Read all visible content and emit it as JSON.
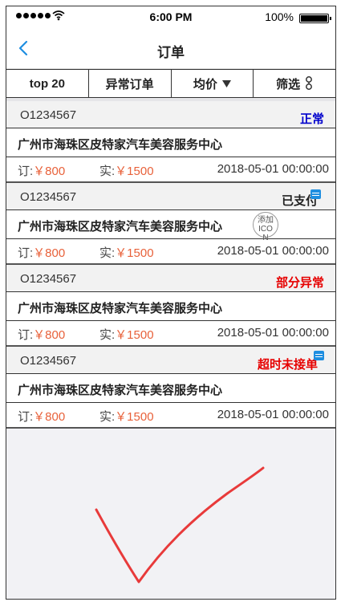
{
  "status_bar": {
    "time": "6:00 PM",
    "battery": "100%"
  },
  "nav": {
    "title": "订单"
  },
  "filters": [
    {
      "label": "top 20"
    },
    {
      "label": "异常订单"
    },
    {
      "label": "均价"
    },
    {
      "label": "筛选"
    }
  ],
  "order_labels": {
    "ordered": "订:",
    "actual": "实:"
  },
  "orders": [
    {
      "id": "O1234567",
      "status": "正常",
      "status_color": "#0000cc",
      "name": "广州市海珠区皮特家汽车美容服务中心",
      "ordered_amount": "￥800",
      "actual_amount": "￥1500",
      "datetime": "2018-05-01 00:00:00"
    },
    {
      "id": "O1234567",
      "status": "已支付",
      "status_color": "#222222",
      "name": "广州市海珠区皮特家汽车美容服务中心",
      "ordered_amount": "￥800",
      "actual_amount": "￥1500",
      "datetime": "2018-05-01 00:00:00"
    },
    {
      "id": "O1234567",
      "status": "部分异常",
      "status_color": "#e60000",
      "name": "广州市海珠区皮特家汽车美容服务中心",
      "ordered_amount": "￥800",
      "actual_amount": "￥1500",
      "datetime": "2018-05-01 00:00:00"
    },
    {
      "id": "O1234567",
      "status": "超时未接单",
      "status_color": "#e60000",
      "name": "广州市海珠区皮特家汽车美容服务中心",
      "ordered_amount": "￥800",
      "actual_amount": "￥1500",
      "datetime": "2018-05-01 00:00:00"
    }
  ],
  "icon_placeholder": {
    "line1": "添加",
    "line2": "ICO",
    "line3": "N"
  },
  "colors": {
    "accent": "#1e8ee0",
    "amount": "#e8613a",
    "checkmark": "#e83a3a"
  }
}
